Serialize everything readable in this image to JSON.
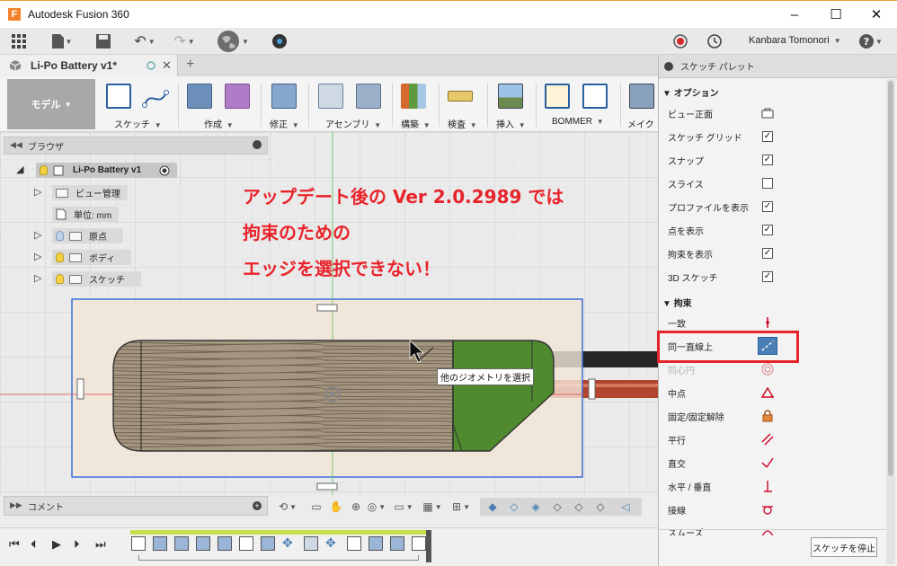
{
  "window": {
    "title": "Autodesk Fusion 360",
    "logo_letter": "F"
  },
  "user": {
    "name": "Kanbara Tomonori"
  },
  "document_tab": {
    "name": "Li-Po Battery v1*"
  },
  "ribbon": {
    "workspace": "モデル",
    "tools": [
      {
        "label": "スケッチ",
        "icon": "sketch-icon"
      },
      {
        "label": "作成",
        "icon": "create-box-icon"
      },
      {
        "label": "修正",
        "icon": "modify-icon"
      },
      {
        "label": "アセンブリ",
        "icon": "assemble-icon"
      },
      {
        "label": "構築",
        "icon": "construct-icon"
      },
      {
        "label": "検査",
        "icon": "inspect-icon"
      },
      {
        "label": "挿入",
        "icon": "insert-image-icon"
      },
      {
        "label": "BOMMER",
        "icon": "bommer-icon"
      },
      {
        "label": "メイク",
        "icon": "make-icon"
      }
    ]
  },
  "browser": {
    "title": "ブラウザ",
    "root": "Li-Po Battery v1",
    "items": [
      "ビュー管理",
      "単位: mm",
      "原点",
      "ボディ",
      "スケッチ"
    ]
  },
  "canvas": {
    "annotation": [
      "アップデート後の Ver 2.0.2989 では",
      "拘束のための",
      "エッジを選択できない！"
    ],
    "tooltip": "他のジオメトリを選択",
    "colors": {
      "sketch_plane": "#f1e4d6",
      "selection": "#3a6fd8",
      "battery_wood": "#a89a86",
      "battery_green": "#4f8a2f"
    }
  },
  "comments": {
    "title": "コメント"
  },
  "palette": {
    "title": "スケッチ パレット",
    "options_title": "オプション",
    "options": [
      {
        "label": "ビュー正面",
        "kind": "icon",
        "icon": "look-at-icon"
      },
      {
        "label": "スケッチ グリッド",
        "kind": "checkbox",
        "checked": "✓"
      },
      {
        "label": "スナップ",
        "kind": "checkbox",
        "checked": "✓"
      },
      {
        "label": "スライス",
        "kind": "checkbox",
        "checked": ""
      },
      {
        "label": "プロファイルを表示",
        "kind": "checkbox",
        "checked": "✓"
      },
      {
        "label": "点を表示",
        "kind": "checkbox",
        "checked": "✓"
      },
      {
        "label": "拘束を表示",
        "kind": "checkbox",
        "checked": "✓"
      },
      {
        "label": "3D スケッチ",
        "kind": "checkbox",
        "checked": "✓"
      }
    ],
    "constraints_title": "拘束",
    "constraints": [
      {
        "label": "一致",
        "icon": "coincident-icon"
      },
      {
        "label": "同一直線上",
        "icon": "collinear-icon",
        "active": true
      },
      {
        "label": "同心円",
        "icon": "concentric-icon",
        "dim": true
      },
      {
        "label": "中点",
        "icon": "midpoint-icon"
      },
      {
        "label": "固定/固定解除",
        "icon": "lock-icon"
      },
      {
        "label": "平行",
        "icon": "parallel-icon"
      },
      {
        "label": "直交",
        "icon": "perpendicular-icon"
      },
      {
        "label": "水平 / 垂直",
        "icon": "horizontal-vertical-icon"
      },
      {
        "label": "接線",
        "icon": "tangent-icon"
      },
      {
        "label": "スムーズ",
        "icon": "smooth-icon"
      }
    ],
    "stop_button": "スケッチを停止"
  }
}
